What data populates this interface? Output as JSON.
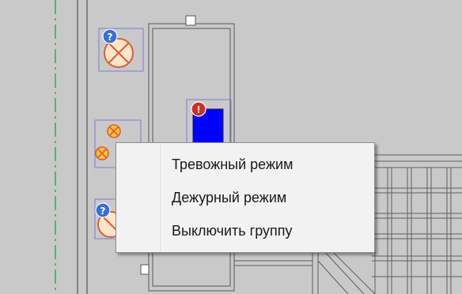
{
  "floor_plan": {
    "background_color": "#c9c9c9",
    "wall_color": "#6e6e6e",
    "guide_line_color": "#3aa64a",
    "markers": [
      {
        "name": "lamp-marker-1",
        "status_icon": "question-icon",
        "lamp_icon": "lamp-off-icon"
      },
      {
        "name": "alarm-device-marker",
        "status_icon": "exclamation-icon",
        "fill_color": "#0000ff"
      },
      {
        "name": "lamp-marker-2",
        "status_icon": "none",
        "lamp_icon": "lamp-on-icon"
      },
      {
        "name": "lamp-marker-3",
        "status_icon": "question-icon",
        "lamp_icon": "lamp-off-icon"
      }
    ]
  },
  "context_menu": {
    "items": [
      {
        "label": "Тревожный режим"
      },
      {
        "label": "Дежурный режим"
      },
      {
        "label": "Выключить группу"
      }
    ]
  }
}
